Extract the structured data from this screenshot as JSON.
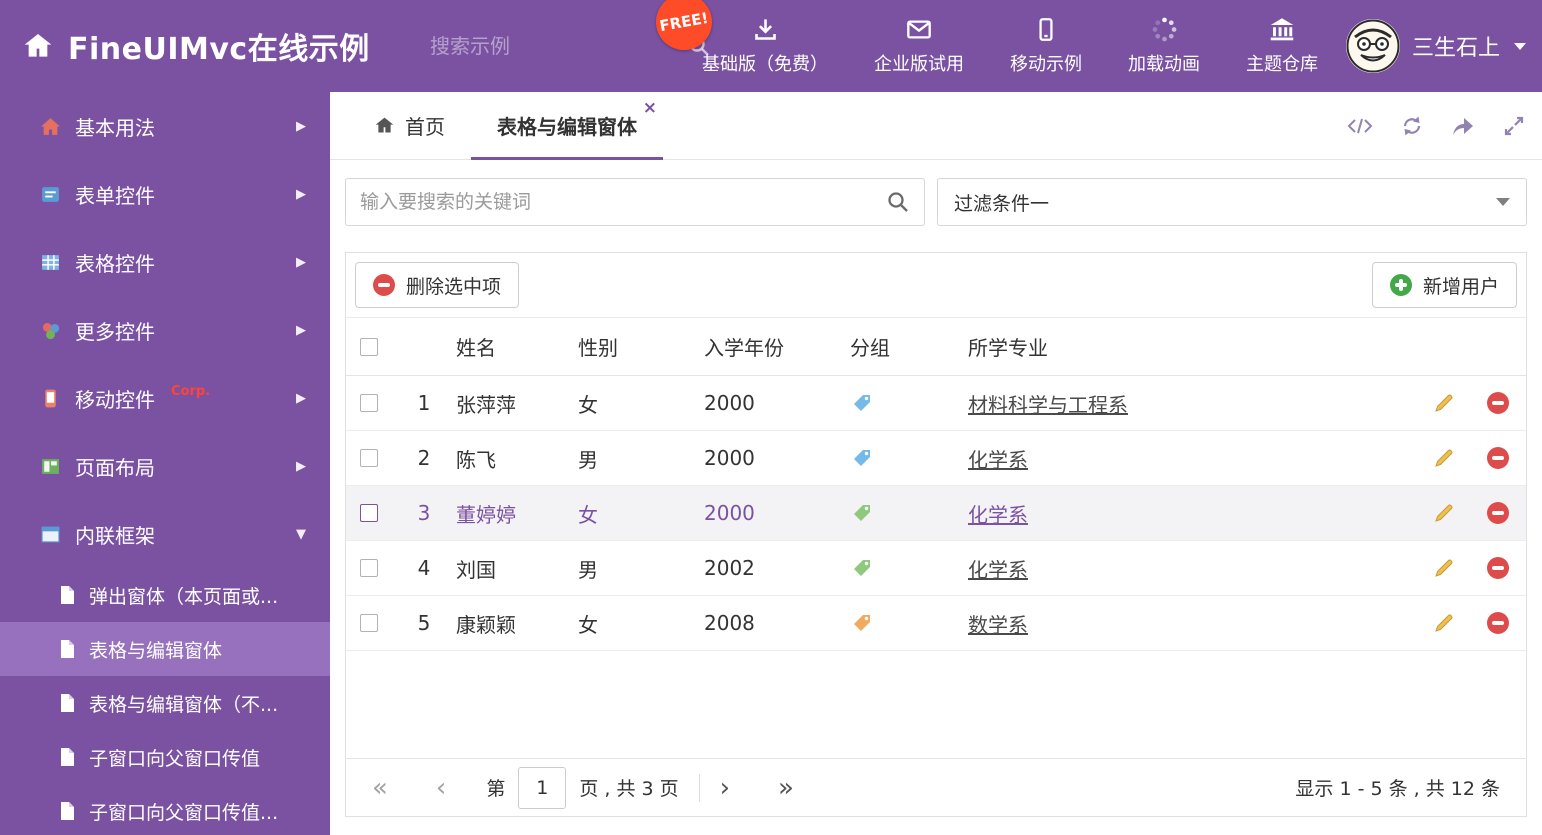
{
  "colors": {
    "primary_purple": "#7b52a2",
    "sidebar_selected": "#9771bd",
    "free_badge_red": "#ff4c28",
    "delete_red": "#de4b4b",
    "add_green": "#44a748",
    "pencil_yellow": "#eec04f",
    "selected_row_text": "#7b52a2"
  },
  "icons": {
    "close": "×",
    "chevron_right": "▶",
    "chevron_down_small": "▼",
    "pag_first": "«",
    "pag_prev": "‹",
    "pag_next": "›",
    "pag_last": "»"
  },
  "header": {
    "title": "FineUIMvc在线示例",
    "search_placeholder": "搜索示例",
    "free_badge": "FREE!",
    "nav_items": [
      {
        "label": "基础版（免费）",
        "icon": "download-icon"
      },
      {
        "label": "企业版试用",
        "icon": "envelope-icon"
      },
      {
        "label": "移动示例",
        "icon": "mobile-icon"
      },
      {
        "label": "加载动画",
        "icon": "spinner-icon"
      },
      {
        "label": "主题仓库",
        "icon": "bank-icon"
      }
    ],
    "username": "三生石上"
  },
  "sidebar": {
    "items": [
      {
        "label": "基本用法"
      },
      {
        "label": "表单控件"
      },
      {
        "label": "表格控件"
      },
      {
        "label": "更多控件"
      },
      {
        "label": "移动控件",
        "badge": "Corp."
      },
      {
        "label": "页面布局"
      },
      {
        "label": "内联框架"
      }
    ],
    "subitems": [
      {
        "label": "弹出窗体（本页面或..."
      },
      {
        "label": "表格与编辑窗体"
      },
      {
        "label": "表格与编辑窗体（不..."
      },
      {
        "label": "子窗口向父窗口传值"
      },
      {
        "label": "子窗口向父窗口传值..."
      }
    ]
  },
  "tabs": {
    "home": "首页",
    "active": "表格与编辑窗体"
  },
  "filterbar": {
    "search_placeholder": "输入要搜索的关键词",
    "filter_value": "过滤条件一"
  },
  "toolbar": {
    "delete_label": "删除选中项",
    "add_label": "新增用户"
  },
  "table": {
    "headers": {
      "name": "姓名",
      "gender": "性别",
      "year": "入学年份",
      "group": "分组",
      "major": "所学专业"
    },
    "rows": [
      {
        "index": "1",
        "name": "张萍萍",
        "gender": "女",
        "year": "2000",
        "tag_color": "#74b9e8",
        "major": "材料科学与工程系"
      },
      {
        "index": "2",
        "name": "陈飞",
        "gender": "男",
        "year": "2000",
        "tag_color": "#74b9e8",
        "major": "化学系"
      },
      {
        "index": "3",
        "name": "董婷婷",
        "gender": "女",
        "year": "2000",
        "tag_color": "#8fc97e",
        "major": "化学系"
      },
      {
        "index": "4",
        "name": "刘国",
        "gender": "男",
        "year": "2002",
        "tag_color": "#8fc97e",
        "major": "化学系"
      },
      {
        "index": "5",
        "name": "康颖颖",
        "gender": "女",
        "year": "2008",
        "tag_color": "#f2aa60",
        "major": "数学系"
      }
    ]
  },
  "pagination": {
    "label_page": "第",
    "current_page": "1",
    "label_total": "页 , 共 3 页",
    "summary": "显示 1 - 5 条 , 共 12 条"
  }
}
